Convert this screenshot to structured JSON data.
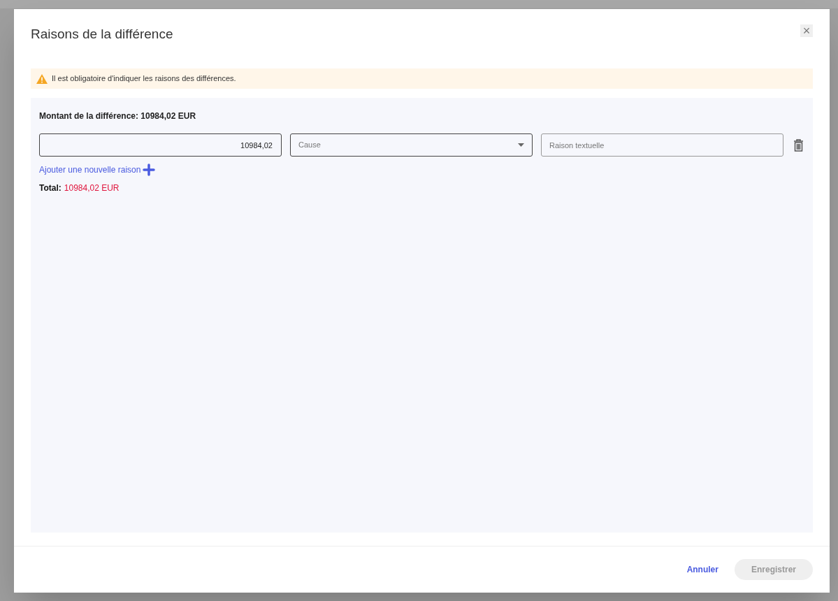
{
  "dialog": {
    "title": "Raisons de la différence",
    "close_label": "×"
  },
  "alert": {
    "kind": "warning",
    "text": "Il est obligatoire d'indiquer les raisons des différences."
  },
  "amount_label": "Montant de la différence: 10984,02 EUR",
  "reasons": [
    {
      "amount": "10984,02",
      "cause_placeholder": "Cause",
      "text_placeholder": "Raison textuelle"
    }
  ],
  "add_link": "Ajouter une nouvelle raison",
  "total": {
    "label": "Total:",
    "value": "10984,02 EUR"
  },
  "buttons": [
    {
      "label": "Annuler",
      "kind": "text",
      "disabled": false
    },
    {
      "label": "Enregistrer",
      "kind": "filled",
      "disabled": true
    }
  ]
}
